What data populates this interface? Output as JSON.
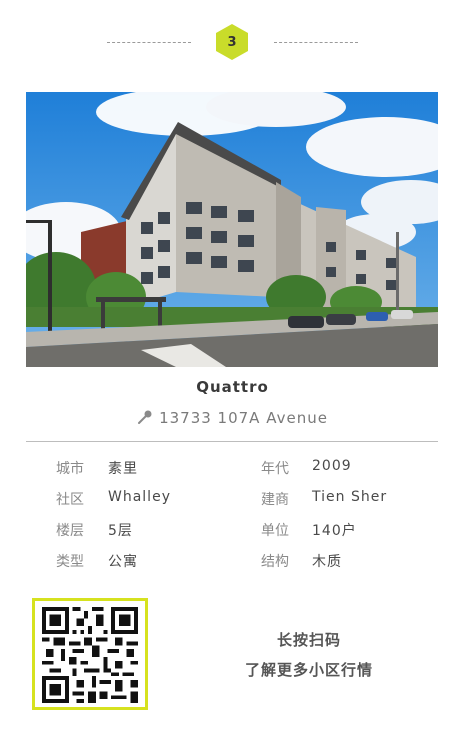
{
  "badge": {
    "number": "3",
    "color": "#c9dc2a"
  },
  "photo": {
    "icon": "building-photo"
  },
  "property": {
    "name": "Quattro",
    "address": "13733 107A Avenue",
    "address_icon": "pin-icon"
  },
  "details": [
    {
      "label": "城市",
      "value": "素里"
    },
    {
      "label": "年代",
      "value": "2009"
    },
    {
      "label": "社区",
      "value": "Whalley"
    },
    {
      "label": "建商",
      "value": "Tien Sher"
    },
    {
      "label": "楼层",
      "value": "5层"
    },
    {
      "label": "单位",
      "value": "140户"
    },
    {
      "label": "类型",
      "value": "公寓"
    },
    {
      "label": "结构",
      "value": "木质"
    }
  ],
  "qr": {
    "icon": "qr-code",
    "frame_color": "#d6e21f"
  },
  "cta": {
    "line1": "长按扫码",
    "line2": "了解更多小区行情"
  }
}
